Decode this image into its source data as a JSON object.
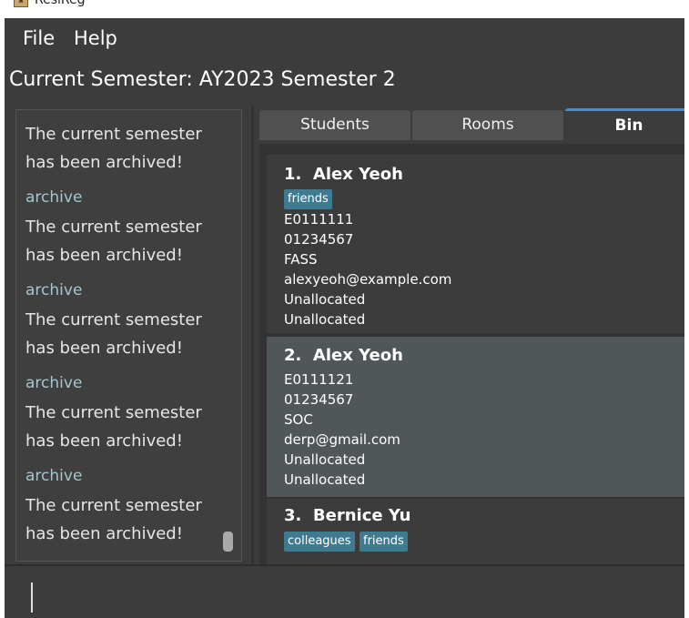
{
  "window": {
    "title": "ResiReg"
  },
  "menu": [
    "File",
    "Help"
  ],
  "semester_label": "Current Semester: AY2023 Semester 2",
  "log": {
    "lines": [
      "The current semester",
      "has been archived!",
      "archive",
      "The current semester",
      "has been archived!",
      "archive",
      "The current semester",
      "has been archived!",
      "archive",
      "The current semester",
      "has been archived!",
      "archive",
      "The current semester",
      "has been archived!"
    ]
  },
  "tabs": [
    "Students",
    "Rooms",
    "Bin"
  ],
  "active_tab": "Bin",
  "bin_items": [
    {
      "index": "1.",
      "name": "Alex Yeoh",
      "tags": [
        "friends"
      ],
      "fields": [
        "E0111111",
        "01234567",
        "FASS",
        "alexyeoh@example.com",
        "Unallocated",
        "Unallocated"
      ]
    },
    {
      "index": "2.",
      "name": "Alex Yeoh",
      "tags": [],
      "fields": [
        "E0111121",
        "01234567",
        "SOC",
        "derp@gmail.com",
        "Unallocated",
        "Unallocated"
      ]
    },
    {
      "index": "3.",
      "name": "Bernice Yu",
      "tags": [
        "colleagues",
        "friends"
      ],
      "fields": []
    }
  ],
  "colors": {
    "background": "#3c3c3c",
    "tag": "#3e7b91",
    "selected_card": "#515658",
    "log_command": "#a7c4cf",
    "active_tab_accent": "#4f8ec9"
  }
}
